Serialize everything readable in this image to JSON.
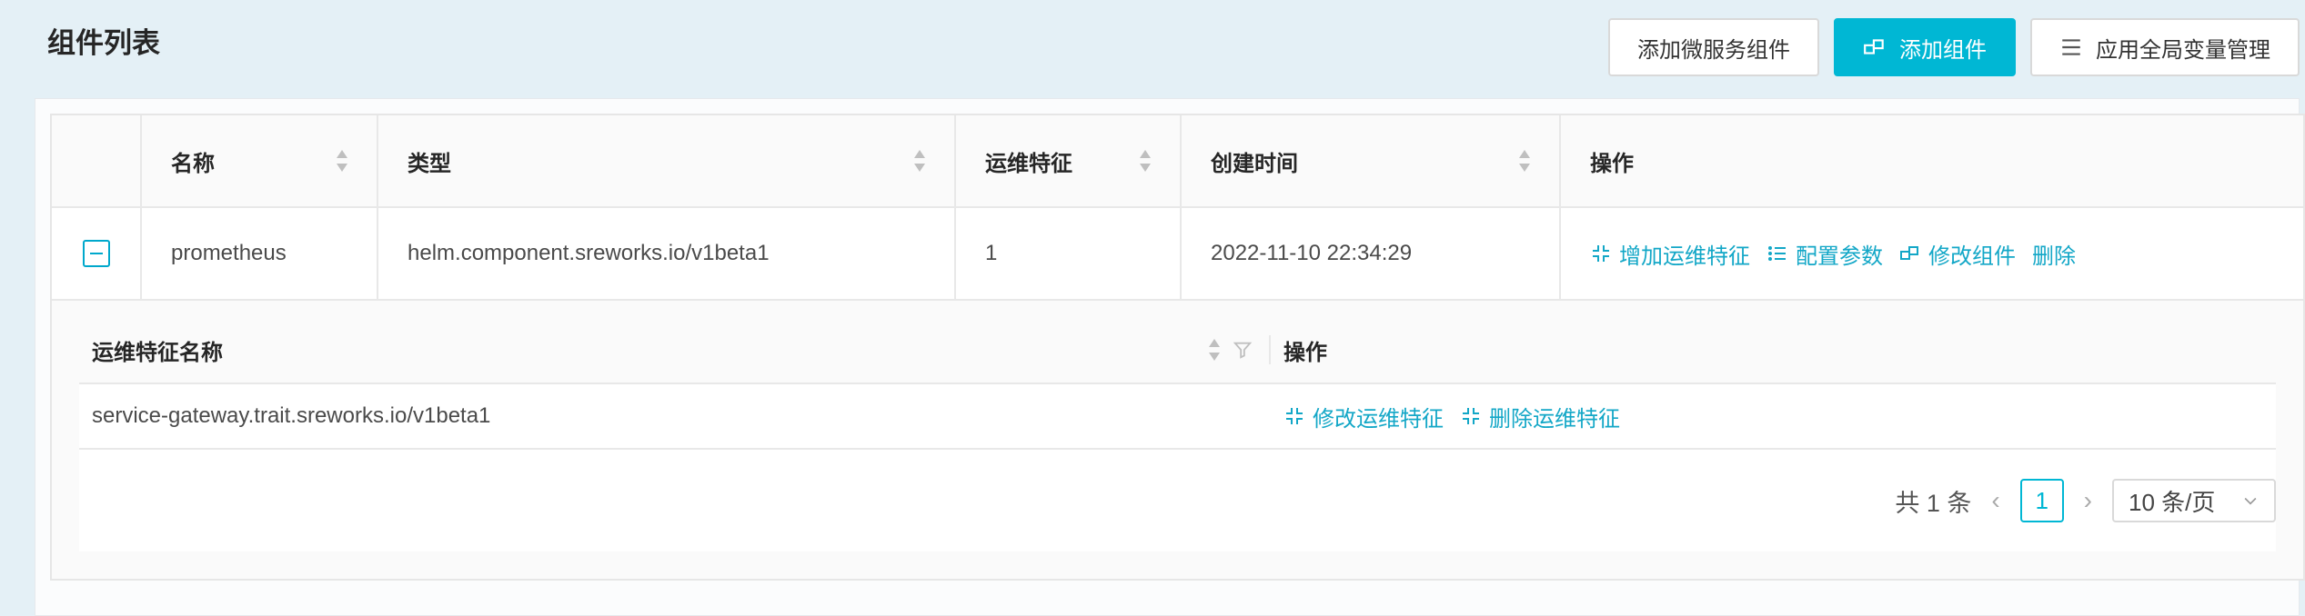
{
  "header": {
    "title": "组件列表",
    "buttons": {
      "add_micro": "添加微服务组件",
      "add_component": "添加组件",
      "env_manage": "应用全局变量管理"
    }
  },
  "table": {
    "columns": [
      "名称",
      "类型",
      "运维特征",
      "创建时间",
      "操作"
    ],
    "row": {
      "name": "prometheus",
      "type": "helm.component.sreworks.io/v1beta1",
      "traits": "1",
      "created": "2022-11-10 22:34:29",
      "actions": {
        "add_trait": "增加运维特征",
        "config": "配置参数",
        "edit": "修改组件",
        "delete": "删除"
      }
    }
  },
  "traits_table": {
    "columns": [
      "运维特征名称",
      "操作"
    ],
    "row": {
      "name": "service-gateway.trait.sreworks.io/v1beta1",
      "actions": {
        "edit": "修改运维特征",
        "delete": "删除运维特征"
      }
    }
  },
  "pagination": {
    "total": "共 1 条",
    "current": "1",
    "page_size": "10 条/页"
  },
  "colors": {
    "accent": "#00b7d4",
    "link": "#13a7c7",
    "background": "#e4f0f6"
  }
}
